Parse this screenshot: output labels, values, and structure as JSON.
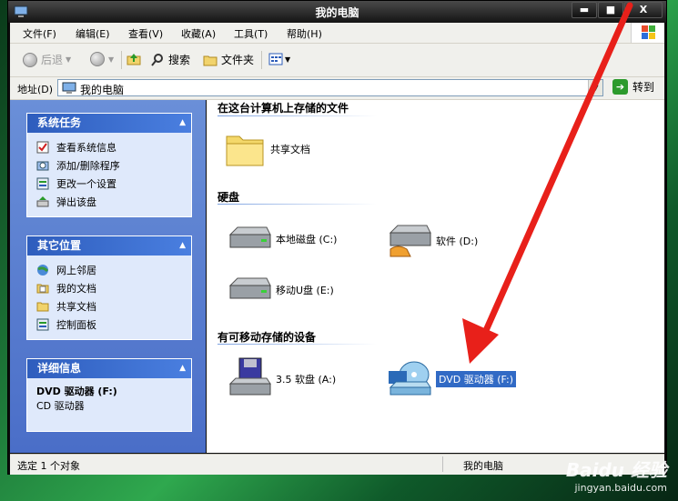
{
  "window": {
    "title": "我的电脑",
    "minimize": "▬",
    "maximize": "■",
    "close": "X"
  },
  "menu": [
    "文件(F)",
    "编辑(E)",
    "查看(V)",
    "收藏(A)",
    "工具(T)",
    "帮助(H)"
  ],
  "toolbar": {
    "back": "后退",
    "search": "搜索",
    "folders": "文件夹"
  },
  "address": {
    "label": "地址(D)",
    "value": "我的电脑",
    "go": "转到"
  },
  "system_tasks": {
    "title": "系统任务",
    "items": [
      "查看系统信息",
      "添加/删除程序",
      "更改一个设置",
      "弹出该盘"
    ]
  },
  "other_places": {
    "title": "其它位置",
    "items": [
      "网上邻居",
      "我的文档",
      "共享文档",
      "控制面板"
    ]
  },
  "details": {
    "title": "详细信息",
    "name": "DVD 驱动器 (F:)",
    "type": "CD 驱动器"
  },
  "groups": {
    "stored": {
      "title": "在这台计算机上存储的文件",
      "items": [
        "共享文档"
      ]
    },
    "hard_disks": {
      "title": "硬盘",
      "items": [
        "本地磁盘 (C:)",
        "软件 (D:)",
        "移动U盘 (E:)"
      ]
    },
    "removable": {
      "title": "有可移动存储的设备",
      "items": [
        "3.5 软盘 (A:)",
        "DVD 驱动器 (F:)"
      ]
    }
  },
  "status": {
    "left": "选定 1 个对象",
    "right": "我的电脑"
  },
  "watermark": {
    "brand": "Baidu 经验",
    "url": "jingyan.baidu.com"
  },
  "colors": {
    "panel_head": "#2e5dbd",
    "panel_body": "#dfe9fb",
    "selection": "#316ac5",
    "arrow": "#e8201a"
  }
}
